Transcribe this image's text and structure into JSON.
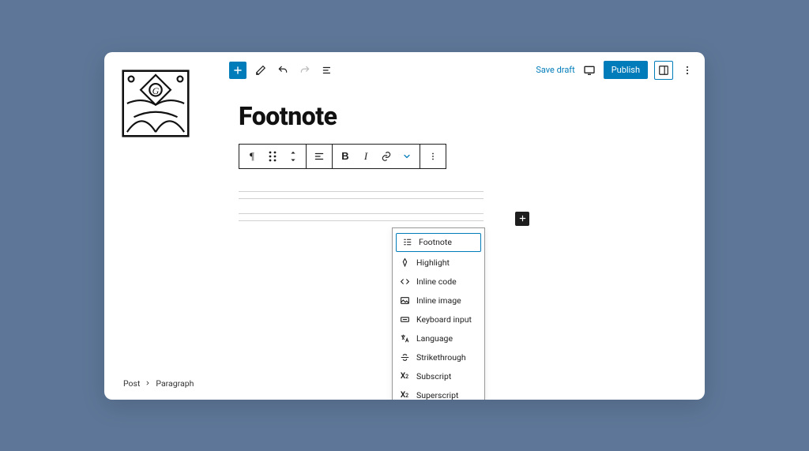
{
  "topbar": {
    "save_draft": "Save draft",
    "publish": "Publish"
  },
  "editor": {
    "title": "Footnote"
  },
  "dropdown": {
    "items": [
      {
        "label": "Footnote"
      },
      {
        "label": "Highlight"
      },
      {
        "label": "Inline code"
      },
      {
        "label": "Inline image"
      },
      {
        "label": "Keyboard input"
      },
      {
        "label": "Language"
      },
      {
        "label": "Strikethrough"
      },
      {
        "label": "Subscript"
      },
      {
        "label": "Superscript"
      }
    ]
  },
  "breadcrumb": {
    "root": "Post",
    "current": "Paragraph"
  }
}
